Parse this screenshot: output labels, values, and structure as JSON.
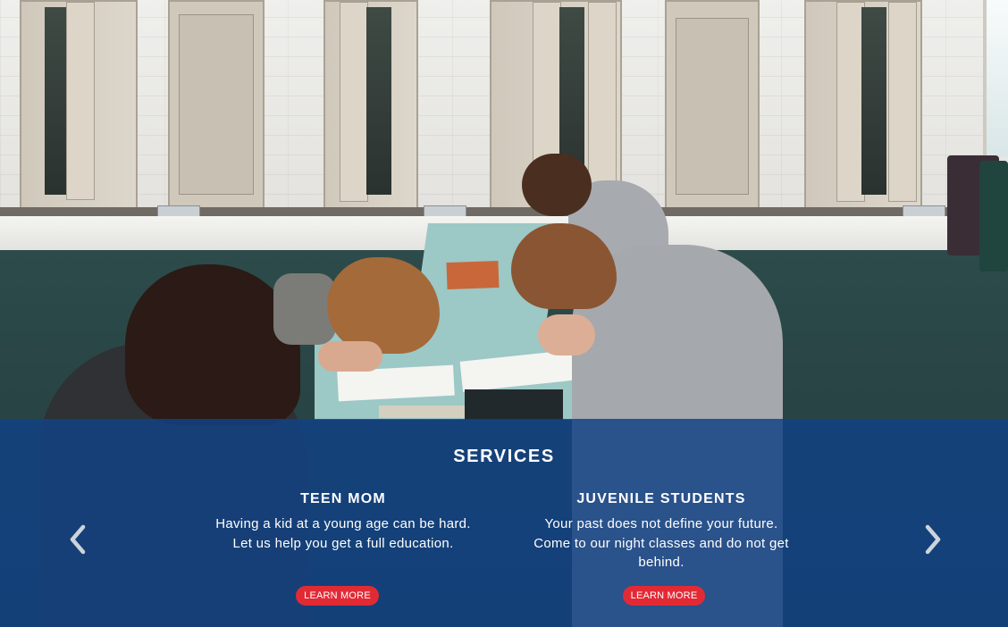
{
  "services": {
    "title": "SERVICES",
    "cards": [
      {
        "heading": "TEEN MOM",
        "body": "Having a kid at a young age can be hard. Let us help you get a full education.",
        "button_label": "LEARN MORE"
      },
      {
        "heading": "JUVENILE STUDENTS",
        "body": "Your past does not define your future. Come to our night classes and do not get behind.",
        "button_label": "LEARN MORE"
      }
    ]
  },
  "carousel": {
    "prev_icon": "chevron-left-icon",
    "next_icon": "chevron-right-icon"
  },
  "colors": {
    "overlay": "#124284",
    "button": "#e22a35",
    "text": "#ffffff"
  }
}
